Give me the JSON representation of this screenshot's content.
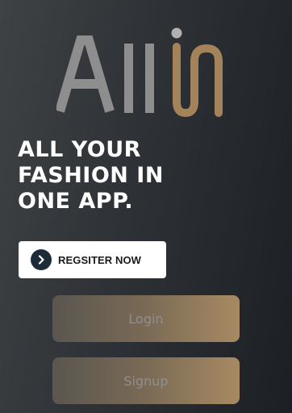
{
  "brand": {
    "logo_text": "Allin",
    "logo_color_light": "#8e8e8e",
    "logo_color_accent": "#a4825a"
  },
  "hero": {
    "line1": "ALL YOUR",
    "line2": "FASHION IN",
    "line3": "ONE APP."
  },
  "actions": {
    "register_label": "REGSITER NOW",
    "login_label": "Login",
    "signup_label": "Signup"
  },
  "icons": {
    "register": "chevron-right-icon"
  }
}
